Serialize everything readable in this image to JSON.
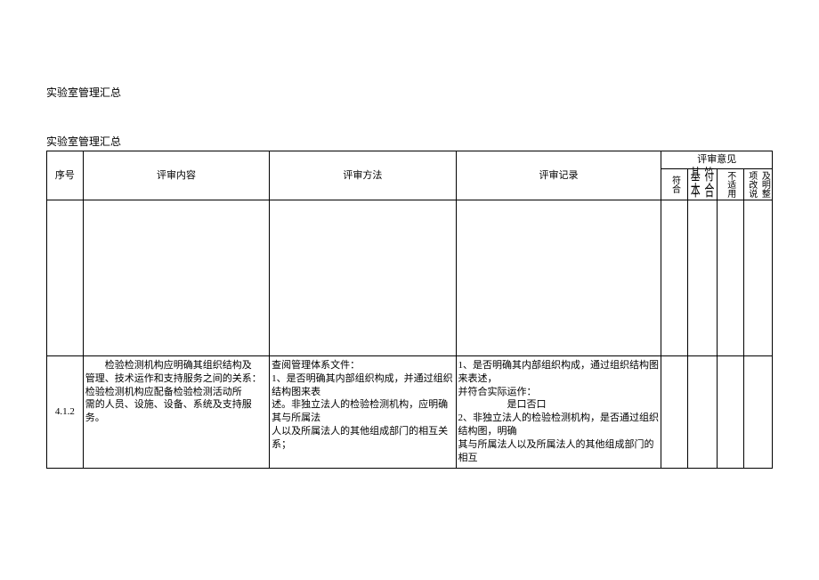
{
  "doc": {
    "title": "实验室管理汇总",
    "caption": "实验室管理汇总"
  },
  "headers": {
    "seq": "序号",
    "content": "评审内容",
    "method": "评审方法",
    "record": "评审记录",
    "opinion_group": "评审意见",
    "op1": "符合",
    "op2a": "基本",
    "op2b": "符合",
    "op3": "不适用",
    "op4a": "项改说",
    "op4b": "及明整"
  },
  "row": {
    "seq": "4.1.2",
    "content_line1": "检验检测机构应明确其组织结构及",
    "content_line2": "管理、技术运作和支持服务之间的关系：",
    "content_line3": "检验检测机构应配备检验检测活动所",
    "content_line4": "需的人员、设施、设备、系统及支持服",
    "content_line5": "务。",
    "method_line1": "查阅管理体系文件：",
    "method_line2": "1、是否明确其内部组织构成，并通过组织结构图来表",
    "method_line3": "述。非独立法人的检验检测机构，应明确其与所属法",
    "method_line4": "人以及所属法人的其他组成部门的相互关系；",
    "record_line1": "1、是否明确其内部组织构成，通过组织结构图来表述，",
    "record_line2": "并符合实际运作：",
    "record_line3_prefix": "是口否口",
    "record_line4": "2、非独立法人的检验检测机构，是否通过组织结构图，明确",
    "record_line5": "其与所属法人以及所属法人的其他组成部门的相互"
  }
}
